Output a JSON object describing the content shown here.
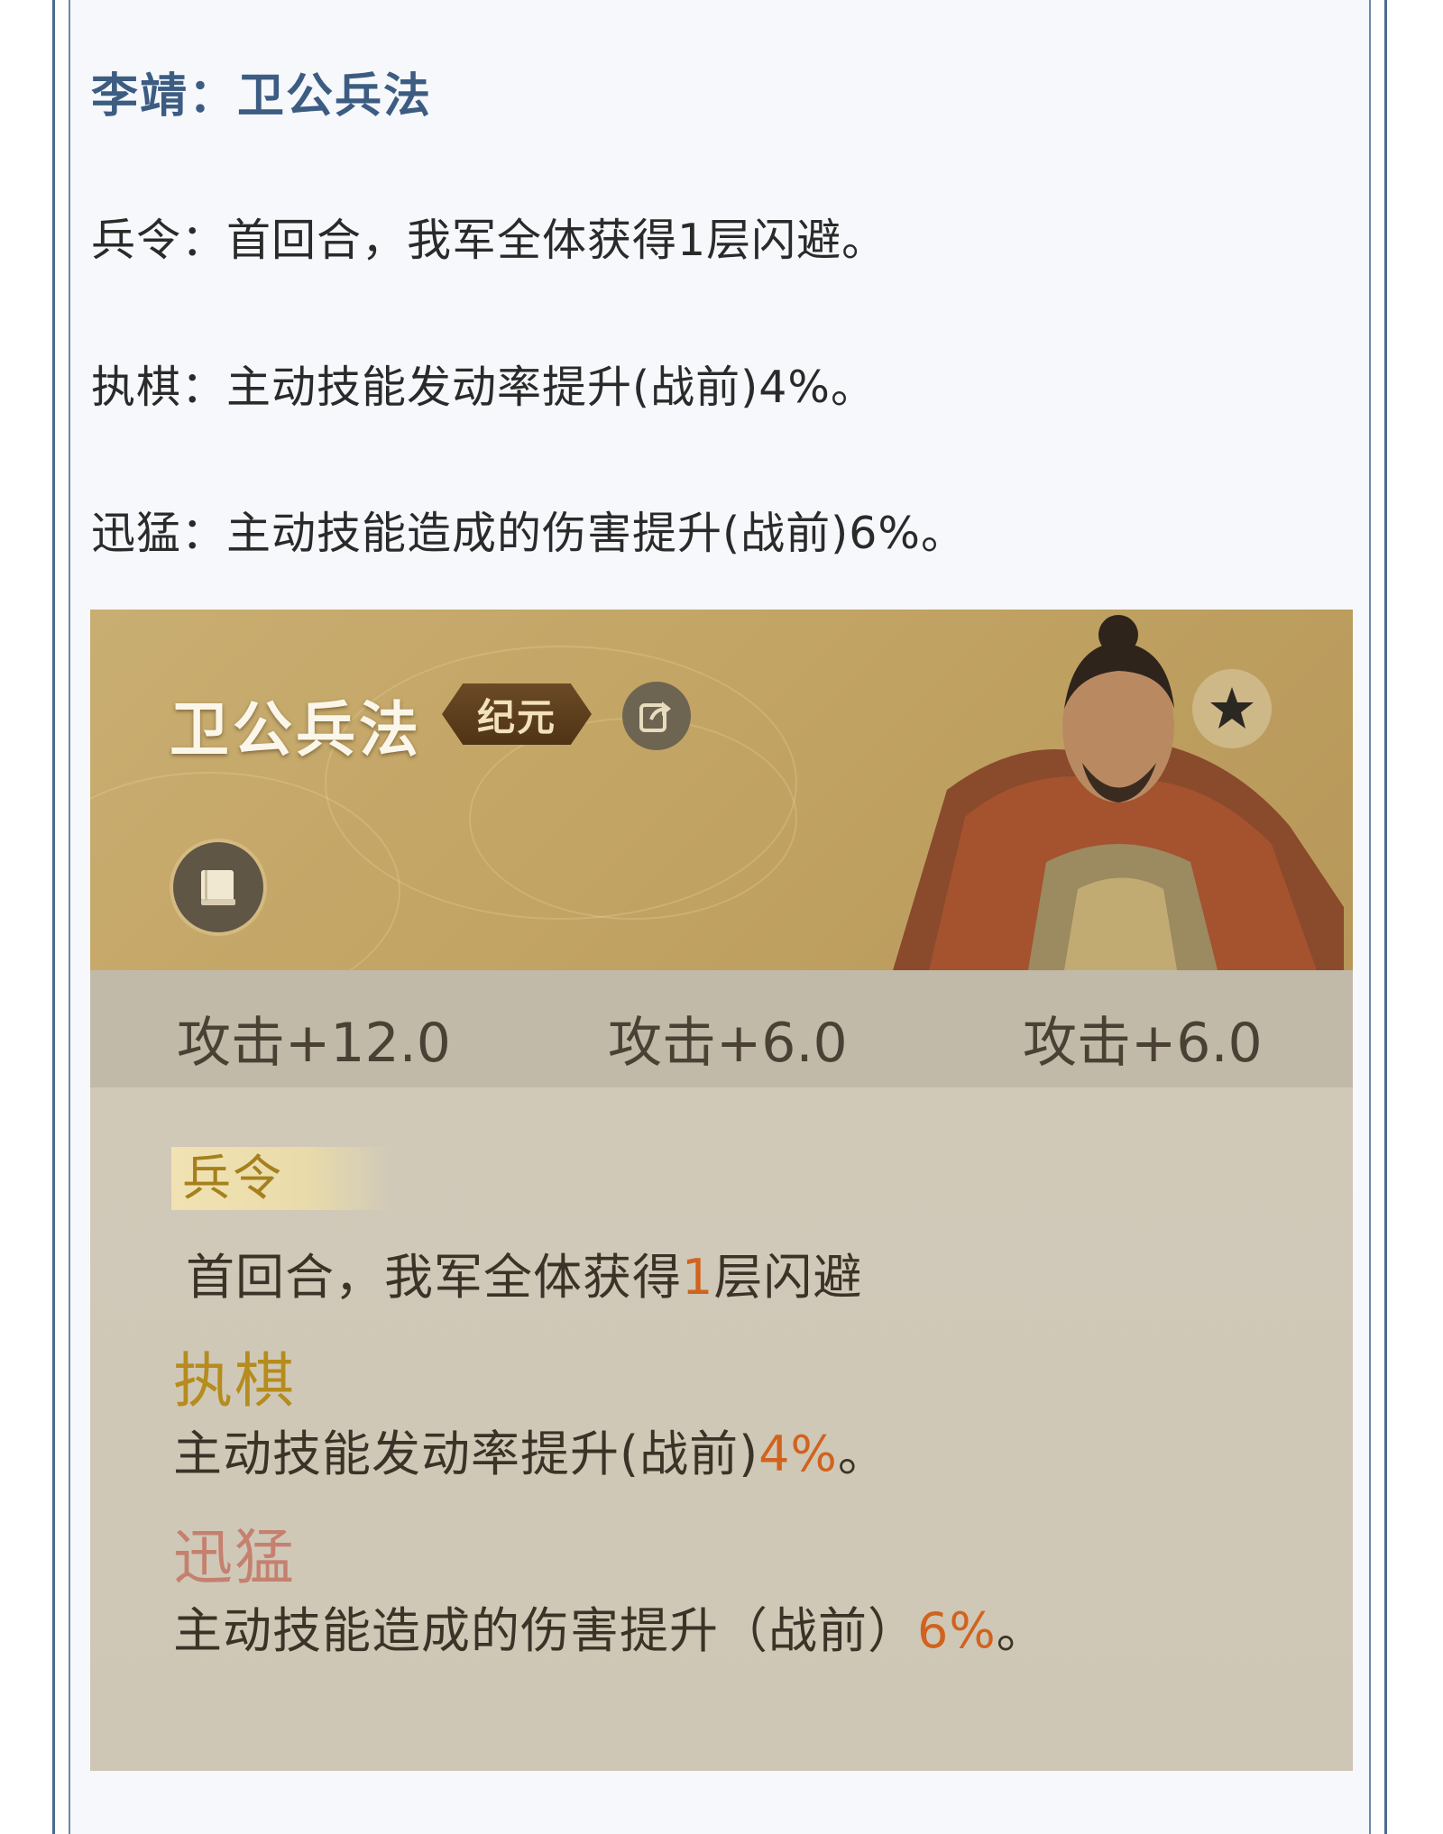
{
  "article": {
    "title": "李靖：卫公兵法",
    "lines": [
      "兵令：首回合，我军全体获得1层闪避。",
      "执棋：主动技能发动率提升(战前)4%。",
      "迅猛：主动技能造成的伤害提升(战前)6%。"
    ]
  },
  "card": {
    "title": "卫公兵法",
    "badge": "纪元",
    "icons": {
      "share": "share-icon",
      "book": "book-icon",
      "star": "star-icon"
    },
    "stats": [
      {
        "label": "攻击",
        "value": "+12.0"
      },
      {
        "label": "攻击",
        "value": "+6.0"
      },
      {
        "label": "攻击",
        "value": "+6.0"
      }
    ],
    "effects": [
      {
        "name": "兵令",
        "pre": "首回合，我军全体获得",
        "highlight": "1",
        "post": "层闪避"
      },
      {
        "name": "执棋",
        "pre": "主动技能发动率提升(战前)",
        "highlight": "4%",
        "post": "。"
      },
      {
        "name": "迅猛",
        "pre": "主动技能造成的伤害提升（战前）",
        "highlight": "6%",
        "post": "。"
      }
    ],
    "colors": {
      "header": "#c3a565",
      "highlight": "#d0631e",
      "name1": "#a5801c",
      "name2": "#b58c1d",
      "name3": "#c5806f"
    }
  }
}
